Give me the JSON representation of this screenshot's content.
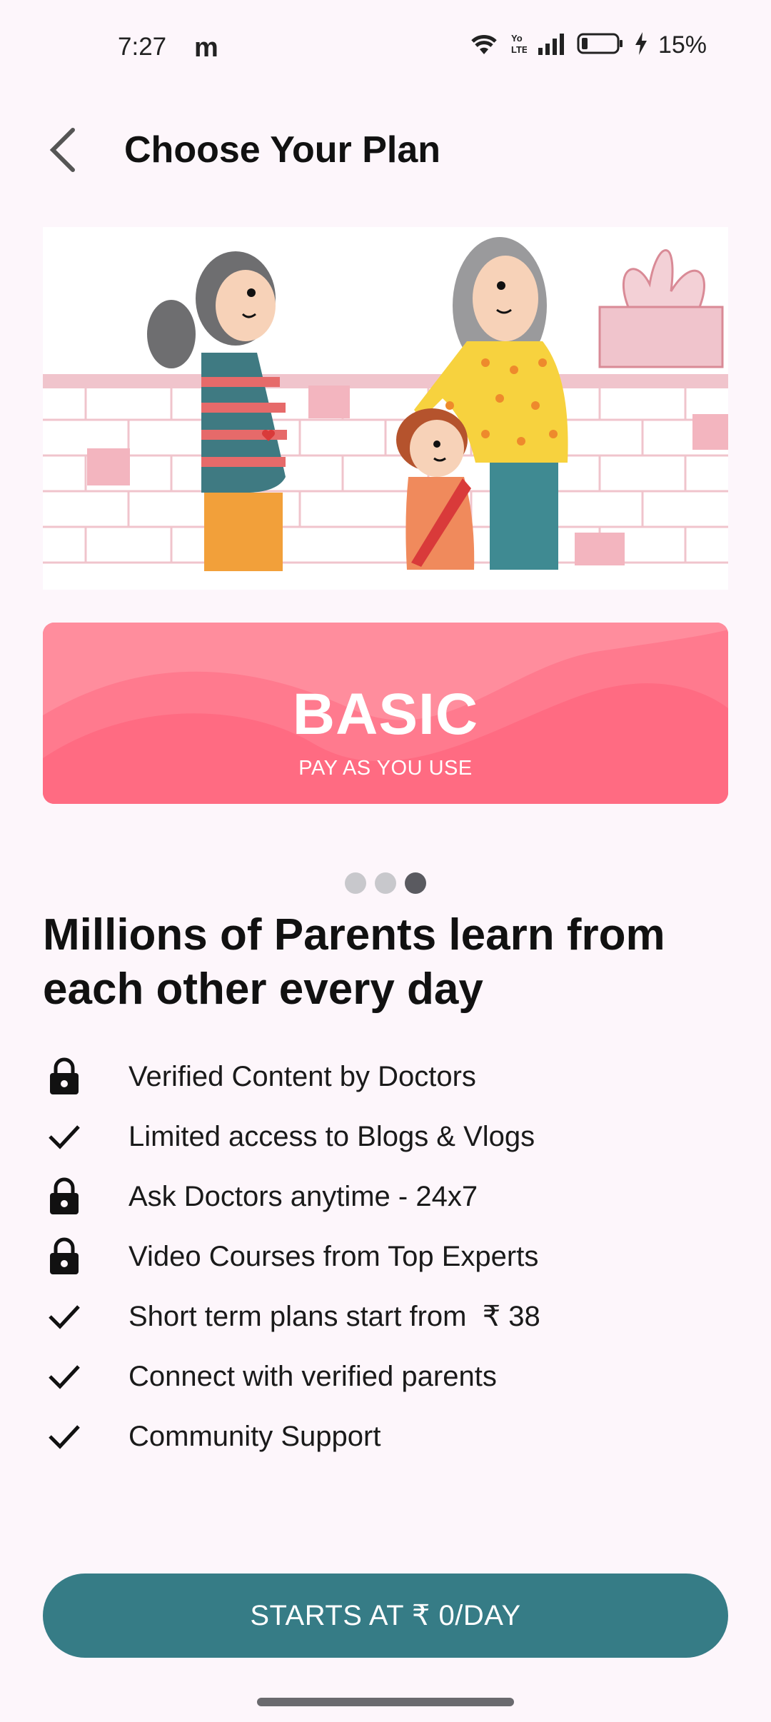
{
  "status_bar": {
    "time": "7:27",
    "app_icon_glyph": "m",
    "battery_text": "15%",
    "icons": [
      "wifi-icon",
      "volte-icon",
      "signal-icon",
      "battery-icon",
      "charging-icon"
    ]
  },
  "header": {
    "title": "Choose Your Plan",
    "back_icon": "chevron-left-icon"
  },
  "plan_card": {
    "name": "BASIC",
    "subtitle": "PAY AS YOU USE",
    "color": "#ff6b82"
  },
  "pager": {
    "count": 3,
    "active_index": 2
  },
  "headline": "Millions of Parents learn from each other every day",
  "features": [
    {
      "icon": "lock-icon",
      "text": "Verified Content by Doctors"
    },
    {
      "icon": "check-icon",
      "text": "Limited access to Blogs & Vlogs"
    },
    {
      "icon": "lock-icon",
      "text": "Ask Doctors anytime - 24x7"
    },
    {
      "icon": "lock-icon",
      "text": "Video Courses from Top Experts"
    },
    {
      "icon": "check-icon",
      "text": "Short term plans start from  ₹ 38"
    },
    {
      "icon": "check-icon",
      "text": "Connect with verified parents"
    },
    {
      "icon": "check-icon",
      "text": "Community Support"
    }
  ],
  "cta": {
    "label": "STARTS AT ₹ 0/DAY",
    "color": "#367c86"
  }
}
